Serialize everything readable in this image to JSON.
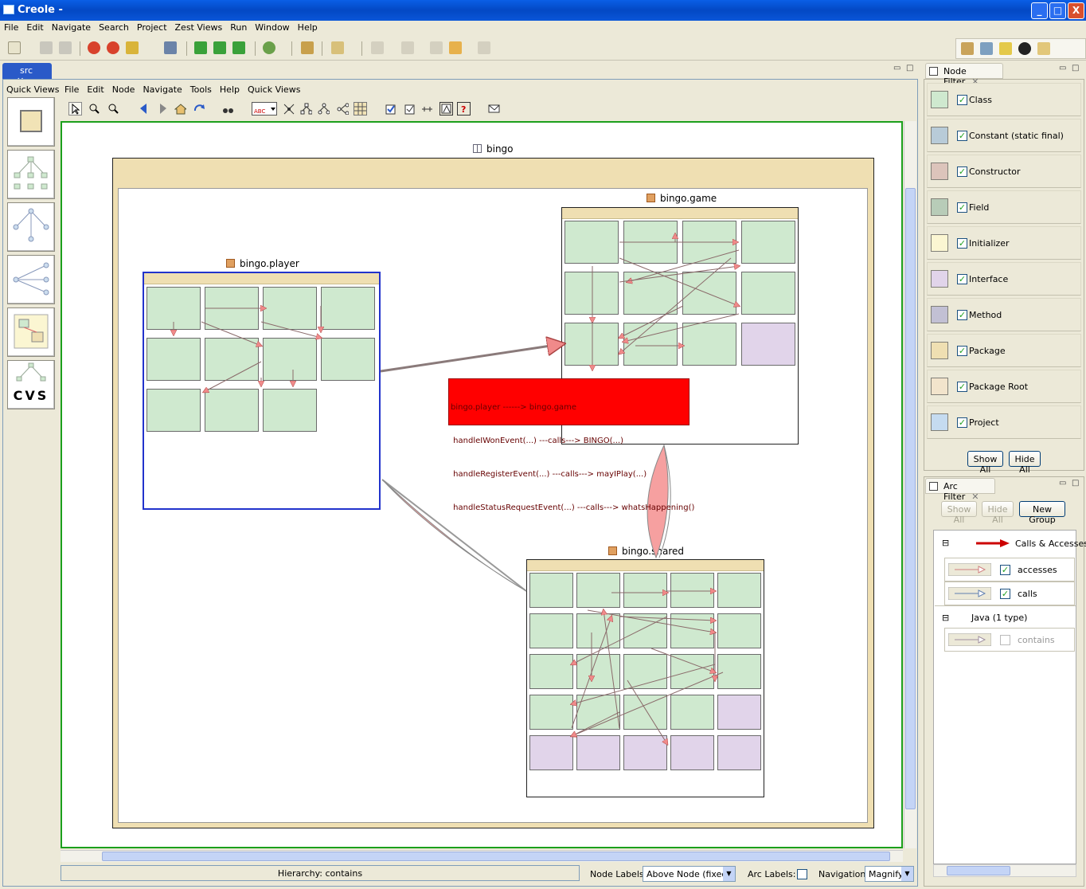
{
  "window": {
    "title": "Creole -",
    "min": "_",
    "max": "□",
    "close": "X"
  },
  "menubar": [
    "File",
    "Edit",
    "Navigate",
    "Search",
    "Project",
    "Zest Views",
    "Run",
    "Window",
    "Help"
  ],
  "editor_tab": {
    "label": "src",
    "close": "✕"
  },
  "quick_views": {
    "label": "Quick Views",
    "cvs_label": "CVS"
  },
  "inner_menu": [
    "File",
    "Edit",
    "Node",
    "Navigate",
    "Tools",
    "Help",
    "Quick Views"
  ],
  "graph": {
    "root_package": "bingo",
    "packages": {
      "game": "bingo.game",
      "player": "bingo.player",
      "shared": "bingo.shared"
    },
    "tooltip": [
      "bingo.player ------> bingo.game",
      " handleIWonEvent(...) ---calls---> BINGO(...)",
      " handleRegisterEvent(...) ---calls---> mayIPlay(...)",
      " handleStatusRequestEvent(...) ---calls---> whatsHappening()"
    ]
  },
  "status": {
    "hierarchy": "Hierarchy: contains",
    "node_labels_label": "Node Labels:",
    "node_labels_value": "Above Node (fixed)",
    "arc_labels_label": "Arc Labels:",
    "navigation_label": "Navigation:",
    "navigation_value": "Magnify"
  },
  "node_filter": {
    "title": "Node Filter",
    "items": [
      {
        "label": "Class",
        "color": "#cfe9cf",
        "checked": true
      },
      {
        "label": "Constant (static final)",
        "color": "#b8cbd8",
        "checked": true
      },
      {
        "label": "Constructor",
        "color": "#dcc4bb",
        "checked": true
      },
      {
        "label": "Field",
        "color": "#b8ccb8",
        "checked": true
      },
      {
        "label": "Initializer",
        "color": "#fbf6d2",
        "checked": true
      },
      {
        "label": "Interface",
        "color": "#e1d4ea",
        "checked": true
      },
      {
        "label": "Method",
        "color": "#c2c0d4",
        "checked": true
      },
      {
        "label": "Package",
        "color": "#efdfb2",
        "checked": true
      },
      {
        "label": "Package Root",
        "color": "#f2e4cc",
        "checked": true
      },
      {
        "label": "Project",
        "color": "#c5dbf0",
        "checked": true
      }
    ],
    "show_all": "Show All",
    "hide_all": "Hide All"
  },
  "arc_filter": {
    "title": "Arc Filter",
    "show_all": "Show All",
    "hide_all": "Hide All",
    "new_group": "New Group",
    "group1": "Calls & Accesses",
    "accesses": "accesses",
    "calls": "calls",
    "group2": "Java (1 type)",
    "contains": "contains",
    "collapse": "⊟"
  }
}
